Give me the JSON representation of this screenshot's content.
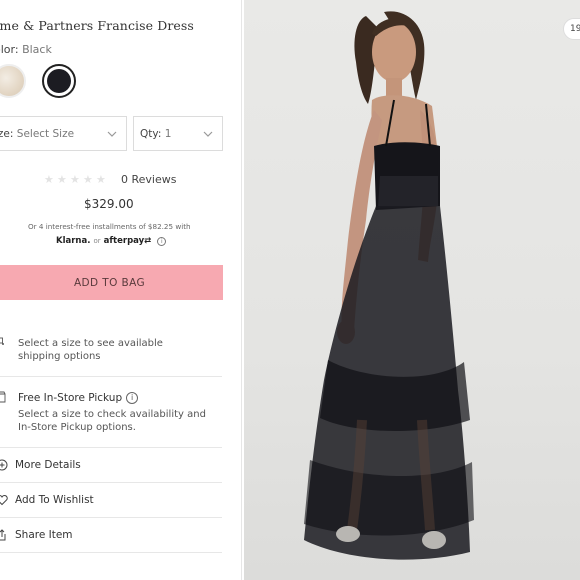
{
  "product": {
    "title": "ame & Partners Francise Dress",
    "color_label": "olor:",
    "color_value": "Black",
    "swatches": [
      {
        "name": "Ivory",
        "color": "#e6dac9"
      },
      {
        "name": "Black",
        "color": "#1c1c22",
        "selected": true
      }
    ]
  },
  "selectors": {
    "size_label": "ize:",
    "size_value": "Select Size",
    "qty_label": "Qty:",
    "qty_value": "1"
  },
  "reviews": {
    "rating": 0,
    "max": 5,
    "count_text": "0 Reviews"
  },
  "pricing": {
    "price": "$329.00",
    "installments": "Or 4 interest-free installments of $82.25 with",
    "klarna": "Klarna.",
    "or": "or",
    "afterpay": "afterpay⇄",
    "info": "i"
  },
  "cta": {
    "add_to_bag": "ADD TO BAG",
    "color": "#f7a9b1"
  },
  "shipping": {
    "text": "Select a size to see available shipping options"
  },
  "pickup": {
    "title": "Free In-Store Pickup",
    "info": "i",
    "text": "Select a size to check availability and In-Store Pickup options."
  },
  "links": {
    "more_details": "More Details",
    "wishlist": "Add To Wishlist",
    "share": "Share Item"
  },
  "image": {
    "counter": "19"
  },
  "icons": {
    "chevron": "chevron-down-icon",
    "truck": "truck-icon",
    "store": "store-icon",
    "plus": "plus-circle-icon",
    "heart": "heart-icon",
    "share": "share-icon"
  }
}
